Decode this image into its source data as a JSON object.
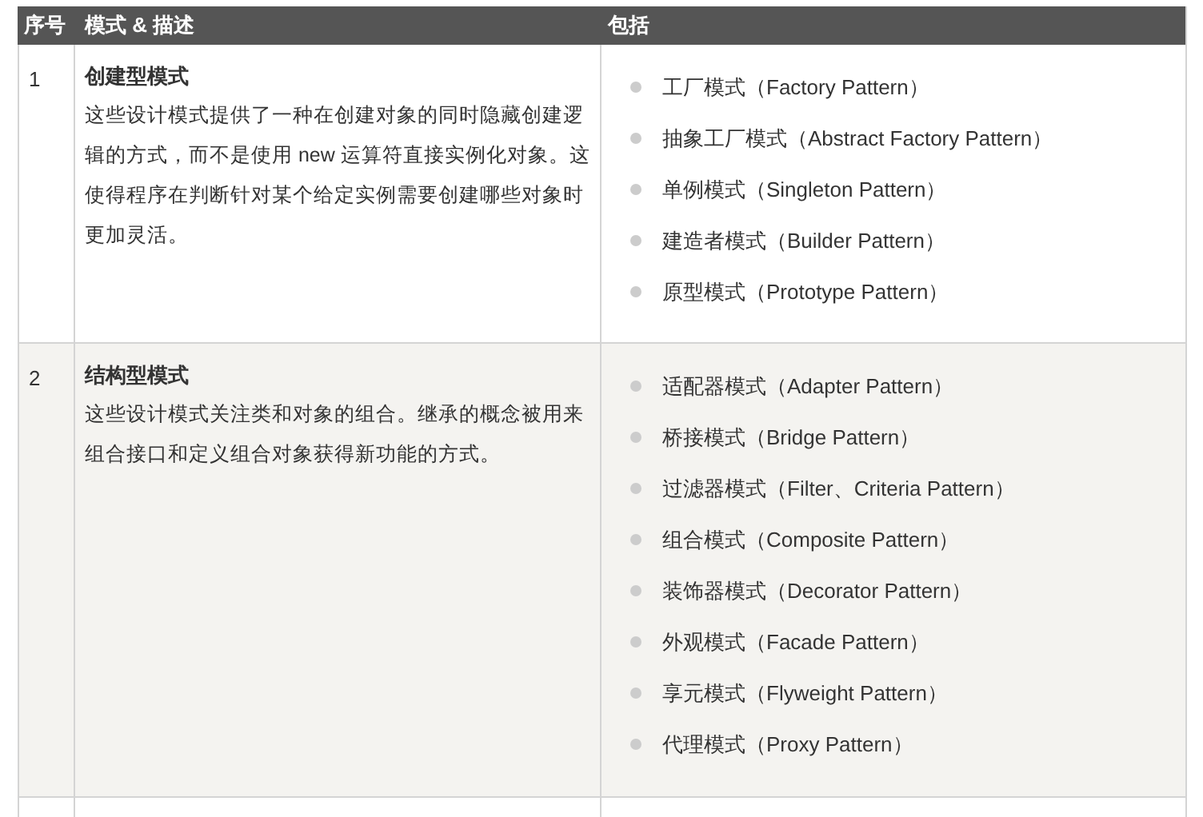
{
  "table": {
    "columns": [
      "序号",
      "模式 & 描述",
      "包括"
    ],
    "rows": [
      {
        "number": "1",
        "title": "创建型模式",
        "description": "这些设计模式提供了一种在创建对象的同时隐藏创建逻辑的方式，而不是使用 new 运算符直接实例化对象。这使得程序在判断针对某个给定实例需要创建哪些对象时更加灵活。",
        "items": [
          "工厂模式（Factory Pattern）",
          "抽象工厂模式（Abstract Factory Pattern）",
          "单例模式（Singleton Pattern）",
          "建造者模式（Builder Pattern）",
          "原型模式（Prototype Pattern）"
        ]
      },
      {
        "number": "2",
        "title": "结构型模式",
        "description": "这些设计模式关注类和对象的组合。继承的概念被用来组合接口和定义组合对象获得新功能的方式。",
        "items": [
          "适配器模式（Adapter Pattern）",
          "桥接模式（Bridge Pattern）",
          "过滤器模式（Filter、Criteria Pattern）",
          "组合模式（Composite Pattern）",
          "装饰器模式（Decorator Pattern）",
          "外观模式（Facade Pattern）",
          "享元模式（Flyweight Pattern）",
          "代理模式（Proxy Pattern）"
        ]
      }
    ]
  }
}
